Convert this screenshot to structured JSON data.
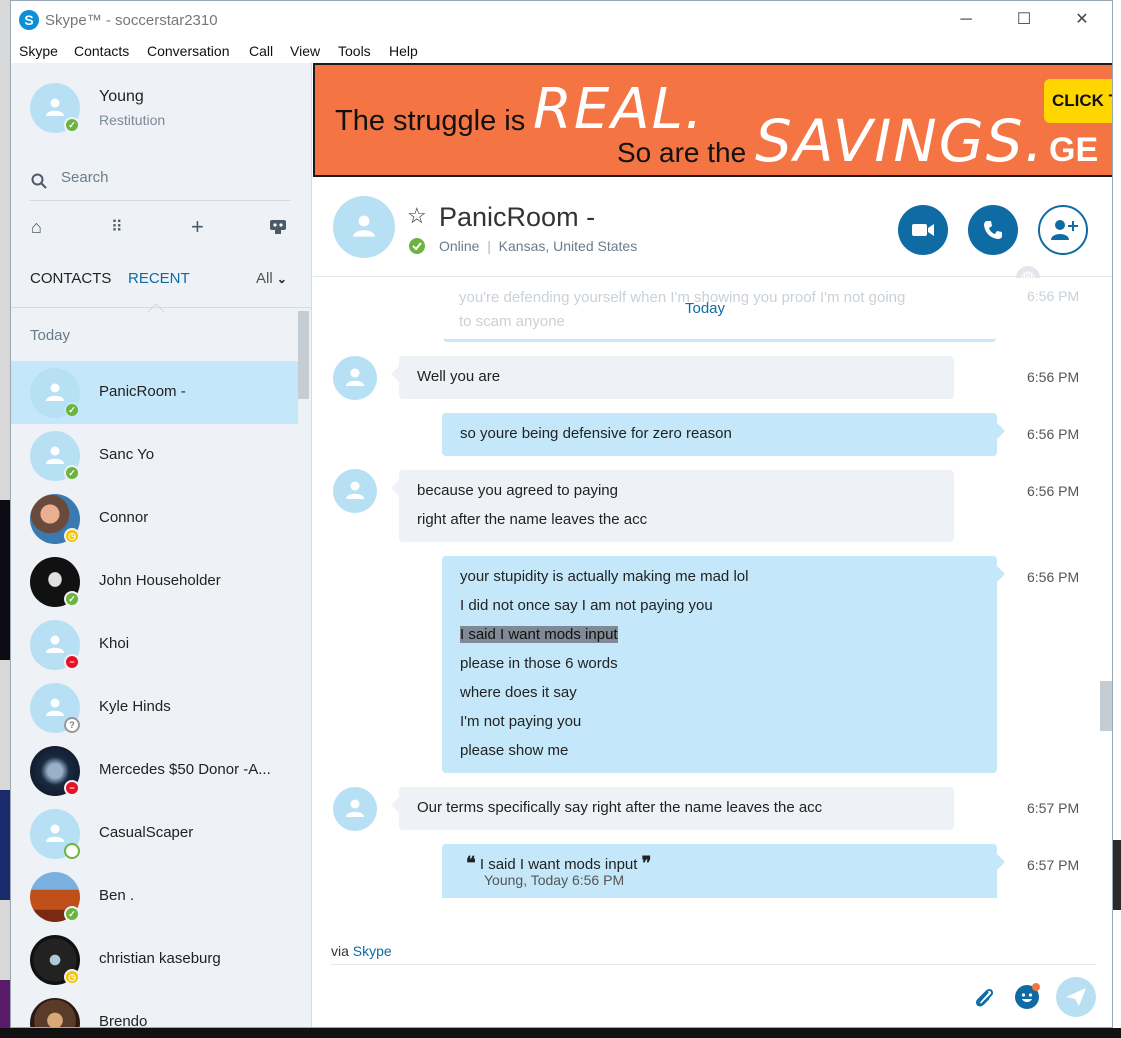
{
  "window": {
    "title": "Skype™ - soccerstar2310",
    "minimize_glyph": "─",
    "maximize_glyph": "☐",
    "close_glyph": "✕"
  },
  "menu": [
    "Skype",
    "Contacts",
    "Conversation",
    "Call",
    "View",
    "Tools",
    "Help"
  ],
  "profile": {
    "name": "Young",
    "status": "Restitution"
  },
  "search": {
    "placeholder": "Search"
  },
  "tabs": {
    "contacts": "CONTACTS",
    "recent": "RECENT",
    "filter": "All"
  },
  "section": "Today",
  "contacts": [
    {
      "name": "PanicRoom -",
      "status": "online",
      "active": true
    },
    {
      "name": "Sanc Yo",
      "status": "online"
    },
    {
      "name": "Connor",
      "status": "away"
    },
    {
      "name": "John Householder",
      "status": "online"
    },
    {
      "name": "Khoi",
      "status": "busy"
    },
    {
      "name": "Kyle Hinds",
      "status": "unknown"
    },
    {
      "name": "Mercedes $50 Donor -A...",
      "status": "busy"
    },
    {
      "name": "CasualScaper",
      "status": "offline"
    },
    {
      "name": "Ben .",
      "status": "online"
    },
    {
      "name": "christian kaseburg",
      "status": "away"
    },
    {
      "name": "Brendo",
      "status": "none"
    }
  ],
  "ad": {
    "line1": "The struggle is",
    "real": "REAL.",
    "line2": "So are the",
    "savings": "SAVINGS.",
    "ge": "GE",
    "click": "CLICK T"
  },
  "conversation": {
    "name": "PanicRoom -",
    "status": "Online",
    "location": "Kansas, United States",
    "separator": "|"
  },
  "chat": {
    "faded_line1": "you're defending yourself when I'm showing you proof I'm not going",
    "faded_line2": "to scam anyone",
    "faded_time": "6:56 PM",
    "today_label": "Today",
    "messages": [
      {
        "dir": "in",
        "lines": [
          "Well you are"
        ],
        "time": "6:56 PM"
      },
      {
        "dir": "out",
        "lines": [
          "so youre being defensive for zero reason"
        ],
        "time": "6:56 PM"
      },
      {
        "dir": "in",
        "lines": [
          "because you agreed to paying",
          "right after the name leaves the acc"
        ],
        "time": "6:56 PM"
      },
      {
        "dir": "out",
        "lines": [
          "your stupidity is actually making me mad lol",
          "I did not once say I am not paying you",
          "I said I want mods input",
          "please in those 6 words",
          "where does it say",
          "I'm not paying you",
          "please show me"
        ],
        "time": "6:56 PM"
      },
      {
        "dir": "in",
        "lines": [
          "Our terms specifically say right after the name leaves  the acc"
        ],
        "time": "6:57 PM"
      },
      {
        "dir": "out",
        "quote": "I said I want mods input",
        "quote_author": "Young, Today 6:56 PM",
        "time": "6:57 PM"
      }
    ]
  },
  "compose": {
    "via_prefix": "via",
    "via_link": "Skype"
  },
  "colors": {
    "accent": "#0e6ba3",
    "selected": "#c4e8fa",
    "online": "#6db33f",
    "away": "#f5c400",
    "busy": "#e81123",
    "ad_bg": "#f47543"
  },
  "icons": [
    "skype-logo-icon",
    "search-icon",
    "home-icon",
    "dialpad-icon",
    "plus-icon",
    "bot-icon",
    "chevron-down-icon",
    "star-icon",
    "video-call-icon",
    "phone-icon",
    "add-contact-icon",
    "globe-icon",
    "attachment-icon",
    "emoticon-icon",
    "send-icon"
  ]
}
